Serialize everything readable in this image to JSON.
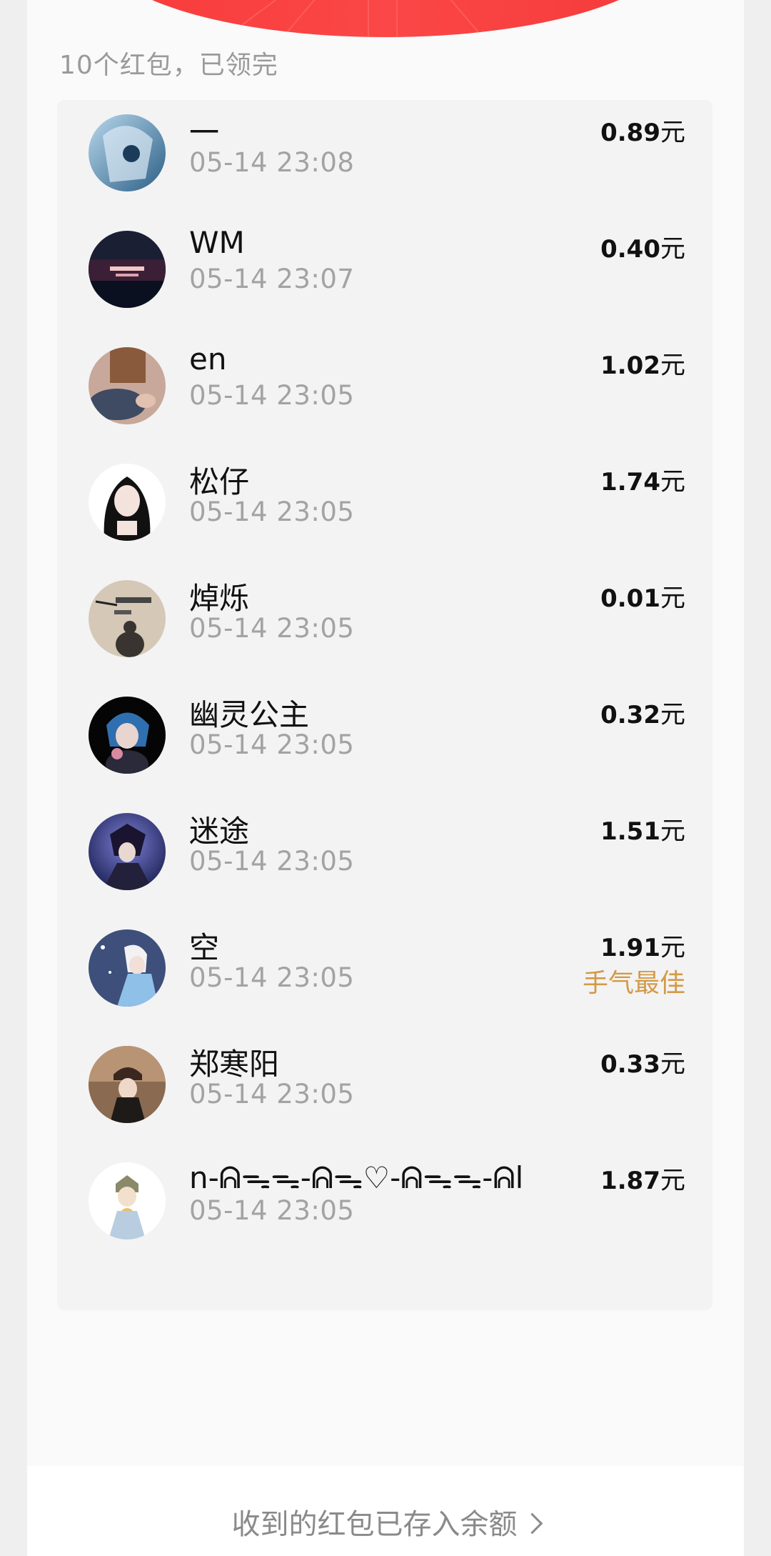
{
  "summary": "10个红包，已领完",
  "unit": "元",
  "best_label": "手气最佳",
  "records": [
    {
      "name": "一",
      "time": "05-14 23:08",
      "amount": "0.89"
    },
    {
      "name": "WM",
      "time": "05-14 23:07",
      "amount": "0.40"
    },
    {
      "name": "en",
      "time": "05-14 23:05",
      "amount": "1.02"
    },
    {
      "name": "松仔",
      "time": "05-14 23:05",
      "amount": "1.74"
    },
    {
      "name": "焯烁",
      "time": "05-14 23:05",
      "amount": "0.01"
    },
    {
      "name": "幽灵公主",
      "time": "05-14 23:05",
      "amount": "0.32"
    },
    {
      "name": "迷途",
      "time": "05-14 23:05",
      "amount": "1.51"
    },
    {
      "name": "空",
      "time": "05-14 23:05",
      "amount": "1.91",
      "best": true
    },
    {
      "name": "郑寒阳",
      "time": "05-14 23:05",
      "amount": "0.33"
    },
    {
      "name": "n-ᕱᯓᯓ-ᕱᯓ♡-ᕱᯓᯓ-ᕱl",
      "time": "05-14 23:05",
      "amount": "1.87"
    }
  ],
  "footer": {
    "link_text": "收到的红包已存入余额"
  },
  "colors": {
    "accent_red": "#f83a3a",
    "best_gold": "#d39a45"
  }
}
